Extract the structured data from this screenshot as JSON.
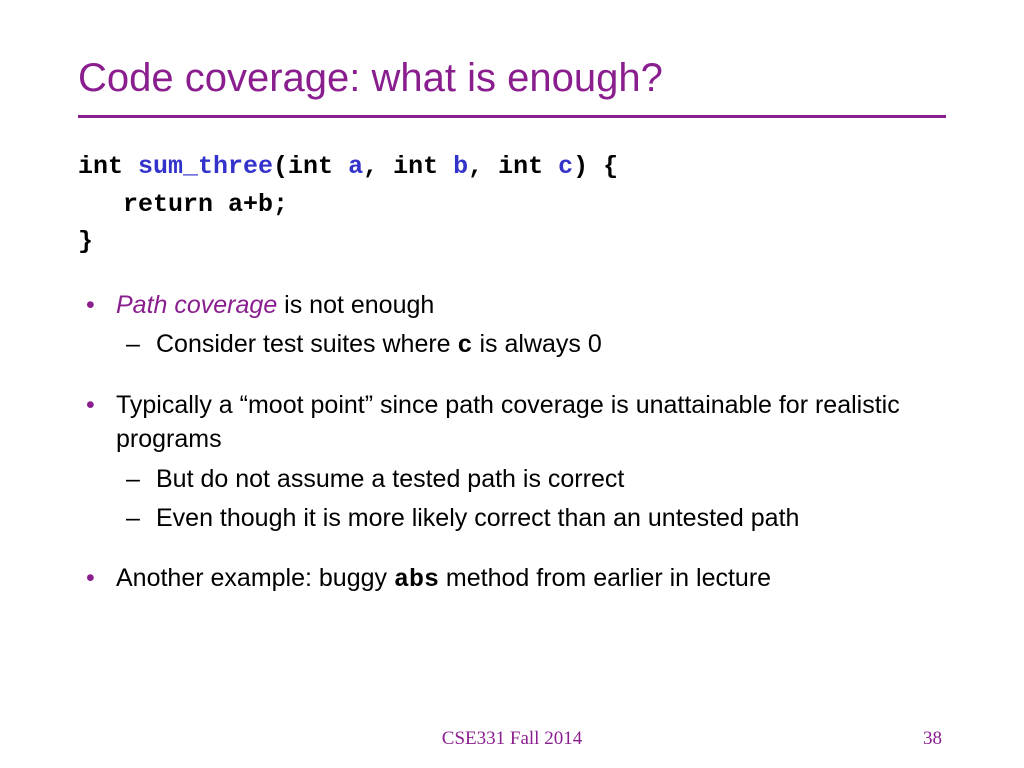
{
  "title": "Code coverage: what is enough?",
  "code": {
    "l1": {
      "t0": "int ",
      "fn": "sum_three",
      "t1": "(int ",
      "a": "a",
      "t2": ", int ",
      "b": "b",
      "t3": ", int ",
      "c": "c",
      "t4": ") {"
    },
    "l2": "   return a+b;",
    "l3": "}"
  },
  "bullets": {
    "b1": {
      "em": "Path coverage",
      "rest": " is not enough"
    },
    "b1s1": {
      "pre": "Consider test suites where ",
      "mono": "c",
      "post": " is always 0"
    },
    "b2": "Typically a “moot point” since path coverage is unattainable for realistic programs",
    "b2s1": "But do not assume a tested path is correct",
    "b2s2": "Even though it is more likely correct than an untested path",
    "b3": {
      "pre": "Another example: buggy ",
      "mono": "abs",
      "post": " method from earlier in lecture"
    }
  },
  "footer": "CSE331 Fall 2014",
  "page": "38"
}
